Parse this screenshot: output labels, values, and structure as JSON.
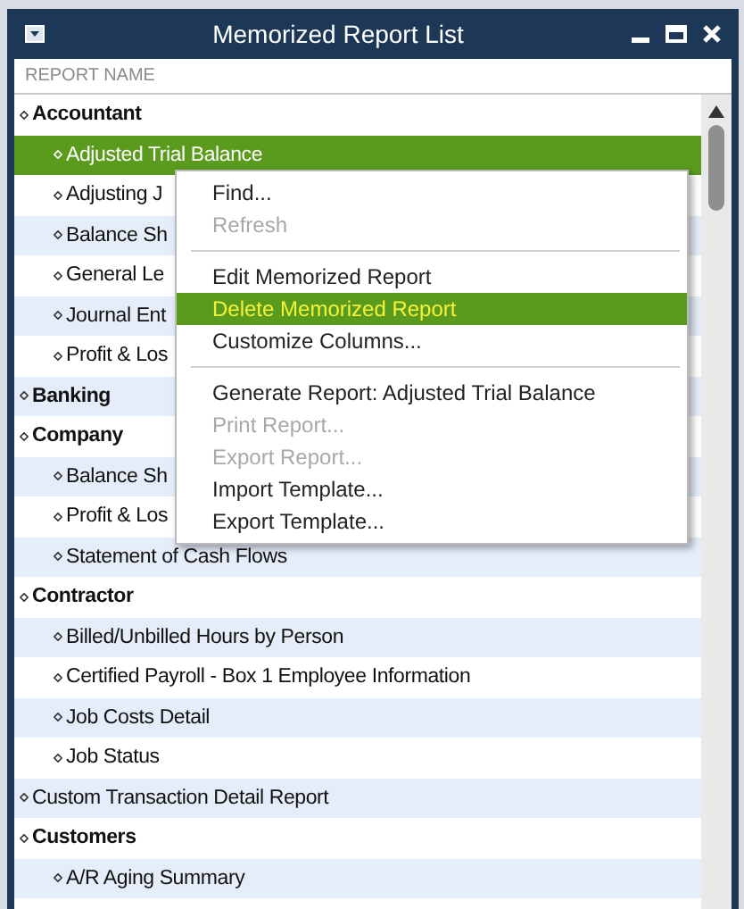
{
  "window": {
    "title": "Memorized Report List"
  },
  "header": {
    "column": "REPORT NAME"
  },
  "tree": [
    {
      "kind": "category",
      "label": "Accountant",
      "selected": false,
      "children": [
        {
          "kind": "report",
          "label": "Adjusted Trial Balance",
          "selected": true
        },
        {
          "kind": "report",
          "label": "Adjusting J",
          "selected": false
        },
        {
          "kind": "report",
          "label": "Balance Sh",
          "selected": false
        },
        {
          "kind": "report",
          "label": "General Le",
          "selected": false
        },
        {
          "kind": "report",
          "label": "Journal Ent",
          "selected": false
        },
        {
          "kind": "report",
          "label": "Profit & Los",
          "selected": false
        }
      ]
    },
    {
      "kind": "category",
      "label": "Banking",
      "selected": false
    },
    {
      "kind": "category",
      "label": "Company",
      "selected": false,
      "children": [
        {
          "kind": "report",
          "label": "Balance Sh",
          "selected": false
        },
        {
          "kind": "report",
          "label": "Profit & Los",
          "selected": false
        },
        {
          "kind": "report",
          "label": "Statement of Cash Flows",
          "selected": false
        }
      ]
    },
    {
      "kind": "category",
      "label": "Contractor",
      "selected": false,
      "children": [
        {
          "kind": "report",
          "label": "Billed/Unbilled Hours by Person",
          "selected": false
        },
        {
          "kind": "report",
          "label": "Certified Payroll - Box 1 Employee Information",
          "selected": false
        },
        {
          "kind": "report",
          "label": "Job Costs Detail",
          "selected": false
        },
        {
          "kind": "report",
          "label": "Job Status",
          "selected": false
        }
      ]
    },
    {
      "kind": "report",
      "label": "Custom Transaction Detail Report",
      "selected": false
    },
    {
      "kind": "category",
      "label": "Customers",
      "selected": false,
      "children": [
        {
          "kind": "report",
          "label": "A/R Aging Summary",
          "selected": false
        }
      ]
    }
  ],
  "context_menu": [
    {
      "kind": "item",
      "label": "Find...",
      "disabled": false,
      "selected": false
    },
    {
      "kind": "item",
      "label": "Refresh",
      "disabled": true,
      "selected": false
    },
    {
      "kind": "separator"
    },
    {
      "kind": "item",
      "label": "Edit Memorized Report",
      "disabled": false,
      "selected": false
    },
    {
      "kind": "item",
      "label": "Delete Memorized Report",
      "disabled": false,
      "selected": true
    },
    {
      "kind": "item",
      "label": "Customize Columns...",
      "disabled": false,
      "selected": false
    },
    {
      "kind": "separator"
    },
    {
      "kind": "item",
      "label": "Generate Report: Adjusted Trial Balance",
      "disabled": false,
      "selected": false
    },
    {
      "kind": "item",
      "label": "Print Report...",
      "disabled": true,
      "selected": false
    },
    {
      "kind": "item",
      "label": "Export Report...",
      "disabled": true,
      "selected": false
    },
    {
      "kind": "item",
      "label": "Import Template...",
      "disabled": false,
      "selected": false
    },
    {
      "kind": "item",
      "label": "Export Template...",
      "disabled": false,
      "selected": false
    }
  ]
}
